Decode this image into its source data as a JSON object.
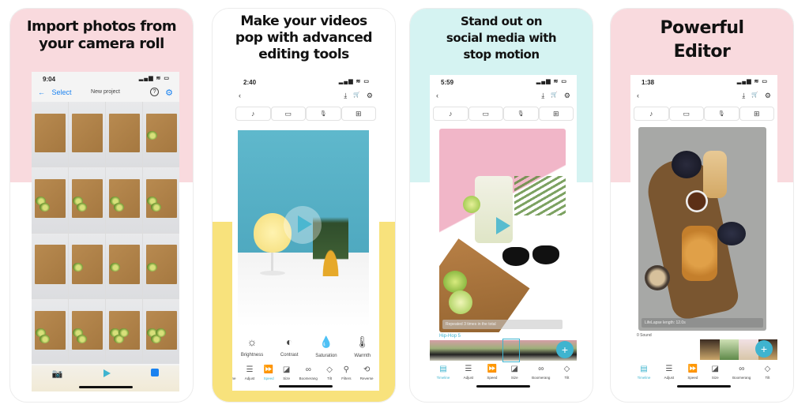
{
  "colors": {
    "pink": "#f9dade",
    "yellow": "#f8e27c",
    "mint": "#d5f3f2",
    "accent": "#3fb4cf",
    "blue": "#1a82f0"
  },
  "panels": [
    {
      "headline": [
        "Import photos from",
        "your camera roll"
      ],
      "status_time": "9:04",
      "nav": {
        "back_label": "Select",
        "title": "New project",
        "help_icon": "?",
        "settings_icon": "⚙"
      },
      "bottom_icons": [
        "camera-icon",
        "play-icon",
        "add-photo-icon"
      ]
    },
    {
      "headline": [
        "Make your videos",
        "pop with advanced",
        "editing tools"
      ],
      "status_time": "2:40",
      "adjustments": [
        {
          "label": "Brightness",
          "icon": "☼"
        },
        {
          "label": "Contrast",
          "icon": "◐"
        },
        {
          "label": "Saturation",
          "icon": "💧"
        },
        {
          "label": "Warmth",
          "icon": "🌡"
        }
      ],
      "tools": [
        {
          "label": "Timeline",
          "icon": "▤"
        },
        {
          "label": "Adjust",
          "icon": "☰"
        },
        {
          "label": "Speed",
          "icon": "⏩",
          "active": true
        },
        {
          "label": "Size",
          "icon": "◪"
        },
        {
          "label": "Boomerang",
          "icon": "∞"
        },
        {
          "label": "Tilt",
          "icon": "◇"
        },
        {
          "label": "Filters",
          "icon": "⚲"
        },
        {
          "label": "Reverse",
          "icon": "⟲"
        },
        {
          "label": "",
          "icon": "⇅"
        }
      ]
    },
    {
      "headline": [
        "Stand out on",
        "social media with",
        "stop motion"
      ],
      "status_time": "5:59",
      "caption": "Repeated 3 times in the total",
      "track_label": "Hip-Hop 5",
      "tools": [
        {
          "label": "Timeline",
          "icon": "▤",
          "active": true
        },
        {
          "label": "Adjust",
          "icon": "☰"
        },
        {
          "label": "Speed",
          "icon": "⏩"
        },
        {
          "label": "Size",
          "icon": "◪"
        },
        {
          "label": "Boomerang",
          "icon": "∞"
        },
        {
          "label": "Tilt",
          "icon": "◇"
        }
      ],
      "fab_label": "+"
    },
    {
      "headline": [
        "Powerful",
        "Editor"
      ],
      "status_time": "1:38",
      "caption": "LifeLapse length: 12.0s",
      "sound_label": "0 Sound",
      "tools": [
        {
          "label": "Timeline",
          "icon": "▤",
          "active": true
        },
        {
          "label": "Adjust",
          "icon": "☰"
        },
        {
          "label": "Speed",
          "icon": "⏩"
        },
        {
          "label": "Size",
          "icon": "◪"
        },
        {
          "label": "Boomerang",
          "icon": "∞"
        },
        {
          "label": "Tilt",
          "icon": "◇"
        }
      ],
      "fab_label": "+"
    }
  ],
  "common": {
    "back_icon": "‹",
    "download_icon": "⤓",
    "cart_icon": "🛒",
    "gear_icon": "⚙",
    "signal": "▂▄▆ ≋ ▭",
    "media_buttons": [
      {
        "name": "music-note-icon",
        "glyph": "♪"
      },
      {
        "name": "folder-icon",
        "glyph": "▭"
      },
      {
        "name": "microphone-icon",
        "glyph": "🎙"
      },
      {
        "name": "grid-icon",
        "glyph": "⊞"
      }
    ]
  }
}
